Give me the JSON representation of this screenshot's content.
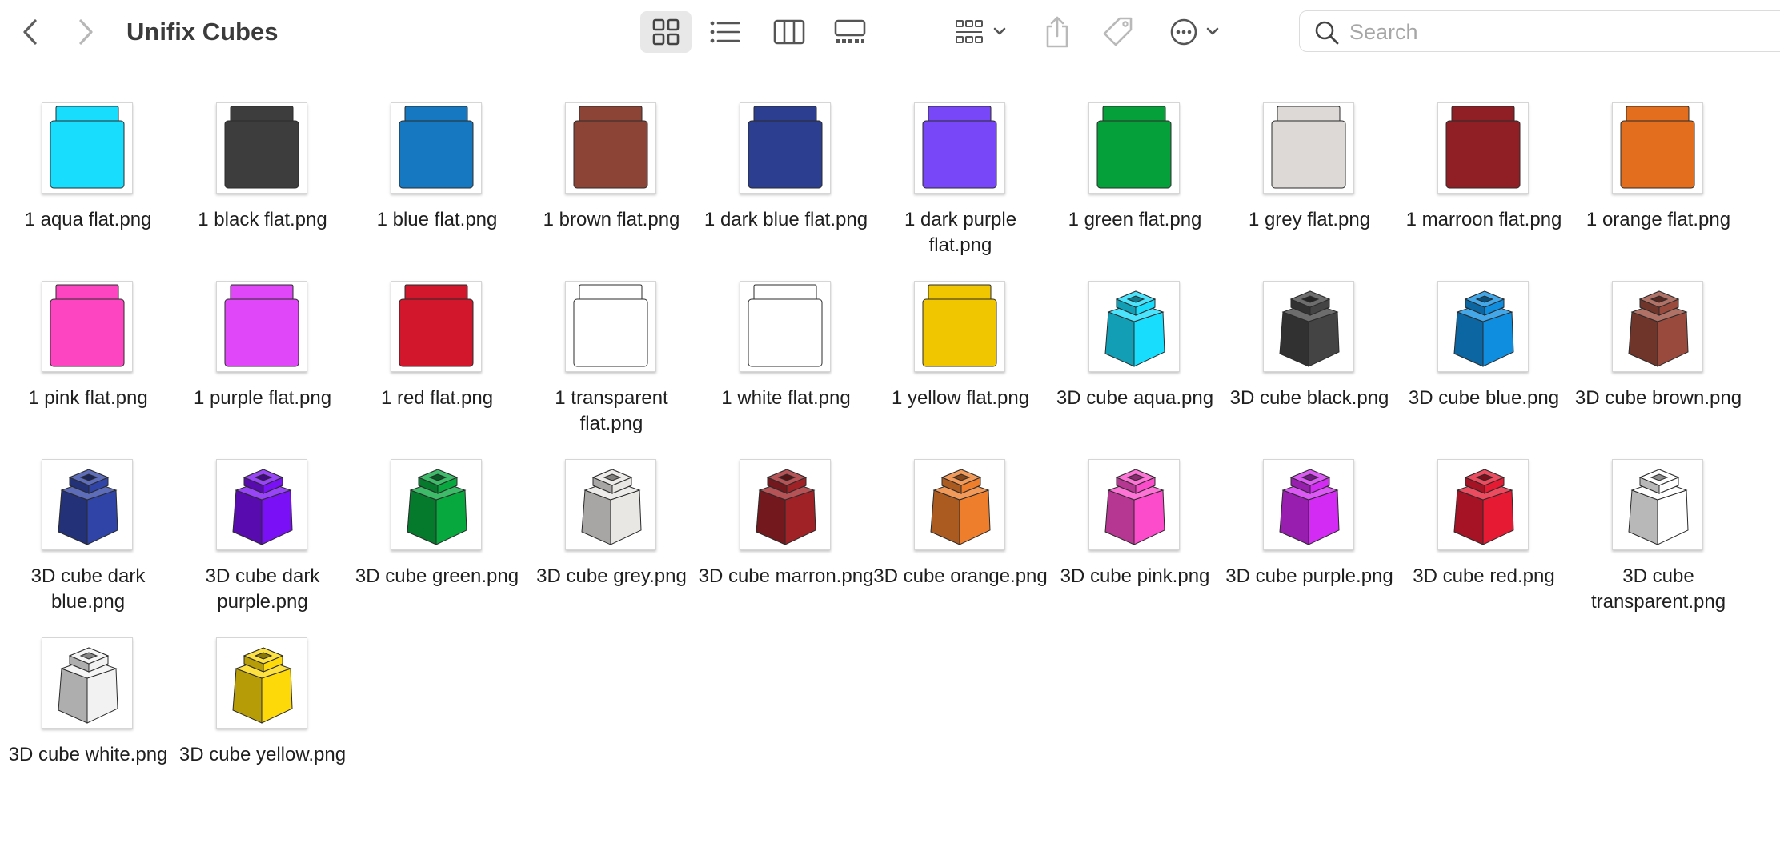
{
  "window": {
    "title": "Unifix Cubes"
  },
  "toolbar": {
    "search_placeholder": "Search",
    "active_view": "icons"
  },
  "files": [
    {
      "name": "1 aqua flat.png",
      "kind": "flat",
      "color": "#19ddfc"
    },
    {
      "name": "1 black flat.png",
      "kind": "flat",
      "color": "#3d3d3d"
    },
    {
      "name": "1 blue flat.png",
      "kind": "flat",
      "color": "#1678c0"
    },
    {
      "name": "1 brown flat.png",
      "kind": "flat",
      "color": "#8c4437"
    },
    {
      "name": "1 dark blue flat.png",
      "kind": "flat",
      "color": "#2c3e90"
    },
    {
      "name": "1 dark purple flat.png",
      "kind": "flat",
      "color": "#7847f7"
    },
    {
      "name": "1 green flat.png",
      "kind": "flat",
      "color": "#05a03a"
    },
    {
      "name": "1 grey flat.png",
      "kind": "flat",
      "color": "#dcd9d7"
    },
    {
      "name": "1 marroon flat.png",
      "kind": "flat",
      "color": "#8f1f25"
    },
    {
      "name": "1 orange flat.png",
      "kind": "flat",
      "color": "#e36e1e"
    },
    {
      "name": "1 pink flat.png",
      "kind": "flat",
      "color": "#fd45c2"
    },
    {
      "name": "1 purple flat.png",
      "kind": "flat",
      "color": "#df47f8"
    },
    {
      "name": "1 red flat.png",
      "kind": "flat",
      "color": "#d2162b"
    },
    {
      "name": "1 transparent flat.png",
      "kind": "flat",
      "color": "#ffffff"
    },
    {
      "name": "1 white flat.png",
      "kind": "flat",
      "color": "#ffffff"
    },
    {
      "name": "1 yellow flat.png",
      "kind": "flat",
      "color": "#f0c601"
    },
    {
      "name": "3D cube aqua.png",
      "kind": "cube",
      "color": "#19ddfc"
    },
    {
      "name": "3D cube black.png",
      "kind": "cube",
      "color": "#444444"
    },
    {
      "name": "3D cube blue.png",
      "kind": "cube",
      "color": "#0f8ee0"
    },
    {
      "name": "3D cube brown.png",
      "kind": "cube",
      "color": "#9a4a3c"
    },
    {
      "name": "3D cube dark blue.png",
      "kind": "cube",
      "color": "#2f44a6"
    },
    {
      "name": "3D cube dark purple.png",
      "kind": "cube",
      "color": "#7a10f5"
    },
    {
      "name": "3D cube green.png",
      "kind": "cube",
      "color": "#07a83d"
    },
    {
      "name": "3D cube grey.png",
      "kind": "cube",
      "color": "#e8e7e4"
    },
    {
      "name": "3D cube marron.png",
      "kind": "cube",
      "color": "#a02227"
    },
    {
      "name": "3D cube orange.png",
      "kind": "cube",
      "color": "#ee7e2c"
    },
    {
      "name": "3D cube pink.png",
      "kind": "cube",
      "color": "#fd4ccb"
    },
    {
      "name": "3D cube purple.png",
      "kind": "cube",
      "color": "#d32af4"
    },
    {
      "name": "3D cube red.png",
      "kind": "cube",
      "color": "#e61a32"
    },
    {
      "name": "3D cube transparent.png",
      "kind": "cube",
      "color": "#ffffff"
    },
    {
      "name": "3D cube white.png",
      "kind": "cube",
      "color": "#f2f2f2"
    },
    {
      "name": "3D cube yellow.png",
      "kind": "cube",
      "color": "#fdd90a"
    }
  ]
}
